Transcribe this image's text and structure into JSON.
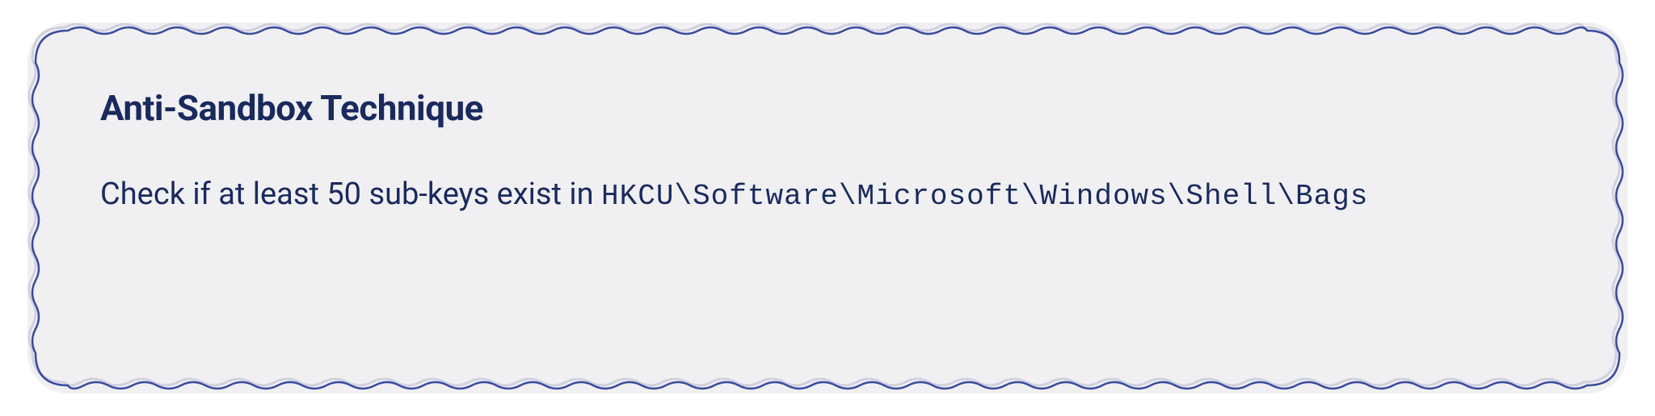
{
  "card": {
    "title": "Anti-Sandbox Technique",
    "description_prefix": "Check if at least 50 sub-keys exist in ",
    "registry_path": "HKCU\\Software\\Microsoft\\Windows\\Shell\\Bags"
  },
  "colors": {
    "text": "#1a2a5e",
    "border_dark": "#3a4a9e",
    "border_light": "#d0d0e0",
    "background": "#f0f0f2"
  }
}
